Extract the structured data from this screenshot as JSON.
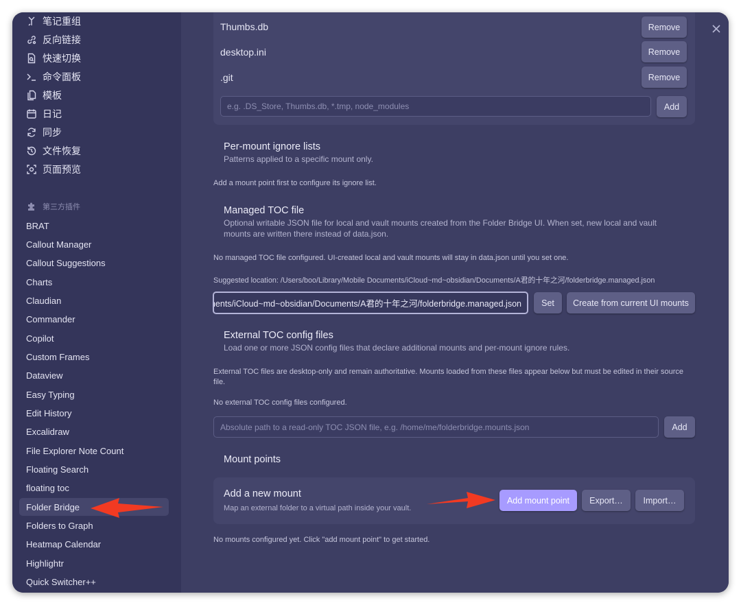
{
  "core_plugins": [
    {
      "label": "笔记重组",
      "icon": "merge-icon"
    },
    {
      "label": "反向链接",
      "icon": "backlink-icon"
    },
    {
      "label": "快速切换",
      "icon": "quick-switch-icon"
    },
    {
      "label": "命令面板",
      "icon": "terminal-icon"
    },
    {
      "label": "模板",
      "icon": "files-icon"
    },
    {
      "label": "日记",
      "icon": "calendar-icon"
    },
    {
      "label": "同步",
      "icon": "sync-icon"
    },
    {
      "label": "文件恢复",
      "icon": "history-icon"
    },
    {
      "label": "页面预览",
      "icon": "preview-icon"
    }
  ],
  "third_party_header": "第三方插件",
  "plugins": [
    "BRAT",
    "Callout Manager",
    "Callout Suggestions",
    "Charts",
    "Claudian",
    "Commander",
    "Copilot",
    "Custom Frames",
    "Dataview",
    "Easy Typing",
    "Edit History",
    "Excalidraw",
    "File Explorer Note Count",
    "Floating Search",
    "floating toc",
    "Folder Bridge",
    "Folders to Graph",
    "Heatmap Calendar",
    "Highlightr",
    "Quick Switcher++"
  ],
  "active_plugin": "Folder Bridge",
  "global_ignore": {
    "items": [
      "Thumbs.db",
      "desktop.ini",
      ".git"
    ],
    "remove_label": "Remove",
    "input_placeholder": "e.g. .DS_Store, Thumbs.db, *.tmp, node_modules",
    "add_label": "Add"
  },
  "per_mount": {
    "name": "Per-mount ignore lists",
    "desc": "Patterns applied to a specific mount only.",
    "note": "Add a mount point first to configure its ignore list."
  },
  "managed_toc": {
    "name": "Managed TOC file",
    "desc_line1": "Optional writable JSON file for local and vault mounts created from the Folder Bridge UI. When set, new local and vault",
    "desc_line2": "mounts are written there instead of data.json.",
    "status": "No managed TOC file configured. UI-created local and vault mounts will stay in data.json until you set one.",
    "suggested": "Suggested location: /Users/boo/Library/Mobile Documents/iCloud~md~obsidian/Documents/A君的十年之河/folderbridge.managed.json",
    "input_value": "ments/iCloud~md~obsidian/Documents/A君的十年之河/folderbridge.managed.json",
    "set_label": "Set",
    "create_label": "Create from current UI mounts"
  },
  "external_toc": {
    "name": "External TOC config files",
    "desc": "Load one or more JSON config files that declare additional mounts and per-mount ignore rules.",
    "note_line1": "External TOC files are desktop-only and remain authoritative. Mounts loaded from these files appear below but must be edited in their source",
    "note_line2": "file.",
    "status": "No external TOC config files configured.",
    "input_placeholder": "Absolute path to a read-only TOC JSON file, e.g. /home/me/folderbridge.mounts.json",
    "add_label": "Add"
  },
  "mount_points": {
    "heading": "Mount points",
    "new_name": "Add a new mount",
    "new_desc": "Map an external folder to a virtual path inside your vault.",
    "add_label": "Add mount point",
    "export_label": "Export…",
    "import_label": "Import…",
    "empty": "No mounts configured yet. Click \"add mount point\" to get started."
  },
  "colors": {
    "accent": "#a79bff",
    "annotation_arrow": "#f23a22",
    "sidebar_bg": "#34355a",
    "main_bg": "#3d3e63"
  }
}
